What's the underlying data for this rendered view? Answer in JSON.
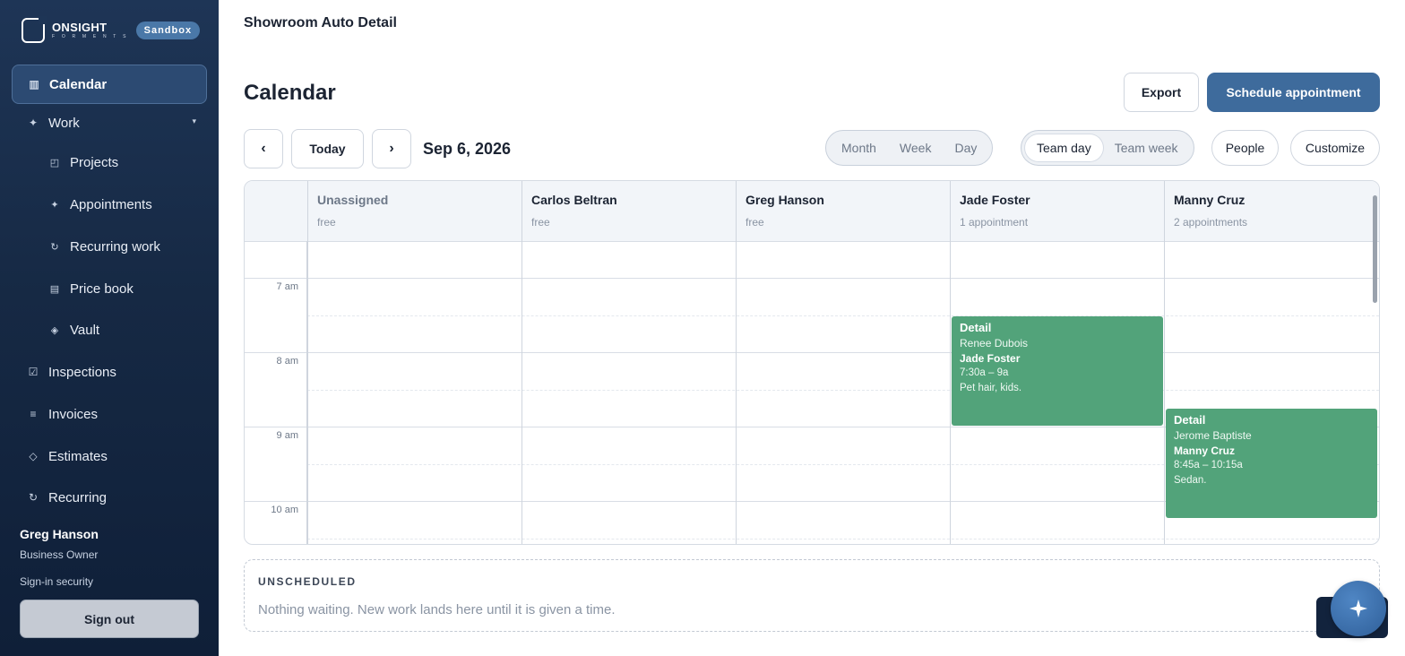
{
  "brand": {
    "name": "ONSIGHT",
    "sub": "F O R M E N T S",
    "badge": "Sandbox"
  },
  "sidebar": {
    "items": [
      {
        "label": "Calendar",
        "icon": "columns-icon",
        "glyph": "▥",
        "active": true
      },
      {
        "label": "Work",
        "icon": "sparkle-icon",
        "glyph": "✦",
        "expandable": true
      },
      {
        "label": "Projects",
        "icon": "project-icon",
        "glyph": "◰",
        "sub": true
      },
      {
        "label": "Appointments",
        "icon": "sparkle-icon",
        "glyph": "✦",
        "sub": true
      },
      {
        "label": "Recurring work",
        "icon": "refresh-icon",
        "glyph": "↻",
        "sub": true
      },
      {
        "label": "Price book",
        "icon": "book-icon",
        "glyph": "▤",
        "sub": true
      },
      {
        "label": "Vault",
        "icon": "diamond-icon",
        "glyph": "◈",
        "sub": true
      },
      {
        "label": "Inspections",
        "icon": "checkbox-icon",
        "glyph": "☑"
      },
      {
        "label": "Invoices",
        "icon": "list-icon",
        "glyph": "≡"
      },
      {
        "label": "Estimates",
        "icon": "diamond-outline-icon",
        "glyph": "◇"
      },
      {
        "label": "Recurring",
        "icon": "refresh-icon",
        "glyph": "↻"
      }
    ],
    "user": {
      "name": "Greg Hanson",
      "role": "Business Owner"
    },
    "signin_security": "Sign-in security",
    "signout": "Sign out"
  },
  "header": {
    "org": "Showroom Auto Detail",
    "title": "Calendar",
    "export": "Export",
    "schedule": "Schedule appointment"
  },
  "toolbar": {
    "prev": "‹",
    "today": "Today",
    "next": "›",
    "date": "Sep 6, 2026",
    "views": [
      "Month",
      "Week",
      "Day"
    ],
    "team_views": [
      "Team day",
      "Team week"
    ],
    "team_active": "Team day",
    "people": "People",
    "customize": "Customize"
  },
  "columns": [
    {
      "name": "Unassigned",
      "status": "free"
    },
    {
      "name": "Carlos Beltran",
      "status": "free"
    },
    {
      "name": "Greg Hanson",
      "status": "free"
    },
    {
      "name": "Jade Foster",
      "status": "1 appointment"
    },
    {
      "name": "Manny Cruz",
      "status": "2 appointments"
    }
  ],
  "hours": [
    "7 am",
    "8 am",
    "9 am",
    "10 am"
  ],
  "appointments": [
    {
      "type": "Detail",
      "client": "Renee Dubois",
      "staff": "Jade Foster",
      "time": "7:30a – 9a",
      "note": "Pet hair, kids.",
      "color": "#52a37a"
    },
    {
      "type": "Detail",
      "client": "Jerome Baptiste",
      "staff": "Manny Cruz",
      "time": "8:45a – 10:15a",
      "note": "Sedan.",
      "color": "#52a37a"
    }
  ],
  "unscheduled": {
    "title": "UNSCHEDULED",
    "text": "Nothing waiting. New work lands here until it is given a time."
  },
  "colors": {
    "sidebar": "#162944",
    "primary": "#3e6b9c",
    "appointment": "#52a37a"
  }
}
